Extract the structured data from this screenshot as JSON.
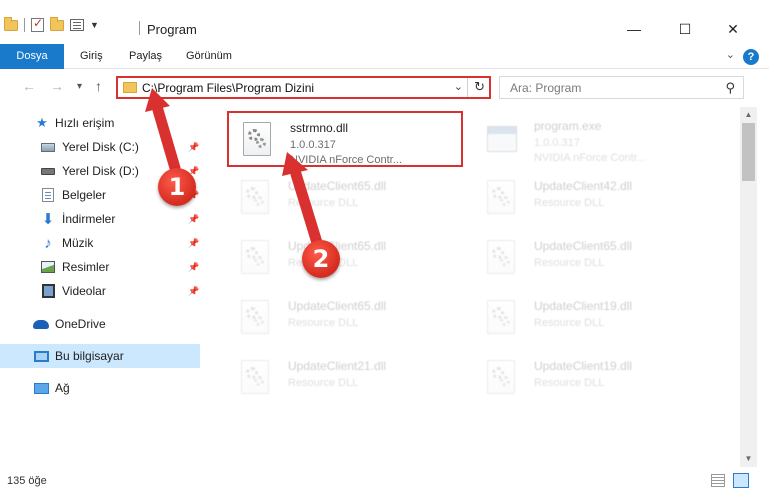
{
  "window": {
    "title": "Program",
    "minimize": "—",
    "maximize": "☐",
    "close": "✕"
  },
  "ribbon": {
    "tabs": [
      "Dosya",
      "Giriş",
      "Paylaş",
      "Görünüm"
    ],
    "help": "?"
  },
  "nav": {
    "back": "←",
    "forward": "→",
    "recent": "▾",
    "up": "↑"
  },
  "address": {
    "path": "C:\\Program Files\\Program Dizini"
  },
  "search": {
    "placeholder": "Ara: Program"
  },
  "sidebar": {
    "items": [
      {
        "label": "Hızlı erişim",
        "icon": "star-icon"
      },
      {
        "label": "Yerel Disk (C:)",
        "icon": "drive-icon",
        "pinned": true
      },
      {
        "label": "Yerel Disk (D:)",
        "icon": "drive-icon",
        "pinned": true
      },
      {
        "label": "Belgeler",
        "icon": "documents-icon",
        "pinned": true
      },
      {
        "label": "İndirmeler",
        "icon": "downloads-icon",
        "pinned": true
      },
      {
        "label": "Müzik",
        "icon": "music-icon",
        "pinned": true
      },
      {
        "label": "Resimler",
        "icon": "pictures-icon",
        "pinned": true
      },
      {
        "label": "Videolar",
        "icon": "videos-icon",
        "pinned": true
      },
      {
        "label": "OneDrive",
        "icon": "onedrive-icon"
      },
      {
        "label": "Bu bilgisayar",
        "icon": "this-pc-icon",
        "selected": true
      },
      {
        "label": "Ağ",
        "icon": "network-icon"
      }
    ]
  },
  "files": [
    {
      "name": "sstrmno.dll",
      "line2": "1.0.0.317",
      "line3": "NVIDIA nForce Contr...",
      "icon": "dll-file-icon",
      "highlighted": true
    },
    {
      "name": "program.exe",
      "line2": "1.0.0.317",
      "line3": "NVIDIA nForce Contr...",
      "icon": "exe-file-icon"
    },
    {
      "name": "UpdateClient65.dll",
      "line2": "Resource DLL",
      "line3": "",
      "icon": "dll-file-icon"
    },
    {
      "name": "UpdateClient42.dll",
      "line2": "Resource DLL",
      "line3": "",
      "icon": "dll-file-icon"
    },
    {
      "name": "UpdateClient65.dll",
      "line2": "Resource DLL",
      "line3": "",
      "icon": "dll-file-icon"
    },
    {
      "name": "UpdateClient65.dll",
      "line2": "Resource DLL",
      "line3": "",
      "icon": "dll-file-icon"
    },
    {
      "name": "UpdateClient65.dll",
      "line2": "Resource DLL",
      "line3": "",
      "icon": "dll-file-icon"
    },
    {
      "name": "UpdateClient19.dll",
      "line2": "Resource DLL",
      "line3": "",
      "icon": "dll-file-icon"
    },
    {
      "name": "UpdateClient21.dll",
      "line2": "Resource DLL",
      "line3": "",
      "icon": "dll-file-icon"
    },
    {
      "name": "UpdateClient19.dll",
      "line2": "Resource DLL",
      "line3": "",
      "icon": "dll-file-icon"
    }
  ],
  "status": {
    "count": "135 öğe"
  },
  "annotations": {
    "step1": "1",
    "step2": "2",
    "color": "#d93030"
  },
  "colors": {
    "accent": "#1979ca",
    "selection": "#cce8ff",
    "highlight": "#d93030"
  }
}
